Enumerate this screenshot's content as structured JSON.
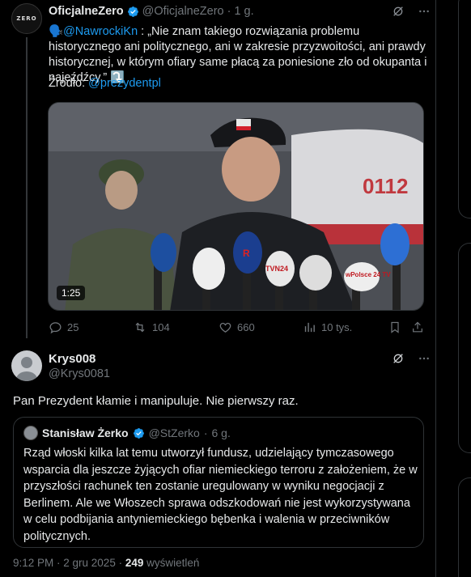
{
  "parent_tweet": {
    "avatar_text": "ZERO",
    "name": "OficjalneZero",
    "handle": "@OficjalneZero",
    "separator": "·",
    "time": "1 g.",
    "mention_prefix": "🗣️",
    "mention": "@NawrockiKn",
    "text": ": „Nie znam takiego rozwiązania problemu historycznego ani politycznego, ani w zakresie przyzwoitości, ani prawdy historycznej, w którym ofiary same płacą za poniesione zło od okupanta i najeźdźcy.” ⤵️",
    "source_label": "Źródło:",
    "source_link": "@prezydentpl",
    "video_duration": "1:25",
    "video_text": {
      "cap_flag": "",
      "plane_number": "0112",
      "mic_labels": [
        "R",
        "TVN24",
        "wPolsce 24 TV"
      ]
    },
    "actions": {
      "replies": "25",
      "reposts": "104",
      "likes": "660",
      "views": "10 tys."
    }
  },
  "reply_tweet": {
    "name": "Krys008",
    "handle": "@Krys0081",
    "text": "Pan Prezydent kłamie i manipuluje. Nie pierwszy raz.",
    "quote": {
      "name": "Stanisław Żerko",
      "handle": "@StZerko",
      "separator": "·",
      "time": "6 g.",
      "text": "Rząd włoski kilka lat temu utworzył fundusz, udzielający tymczasowego wsparcia dla jeszcze żyjących ofiar niemieckiego terroru z założeniem, że w przyszłości rachunek ten zostanie uregulowany w wyniku negocjacji z Berlinem. Ale we Włoszech sprawa odszkodowań nie jest wykorzystywana w celu podbijania antyniemieckiego bębenka i walenia w przeciwników politycznych."
    },
    "meta": {
      "time_date": "9:12 PM · 2 gru 2025 ·",
      "views_count": "249",
      "views_label": "wyświetleń"
    }
  },
  "colors": {
    "background": "#000000",
    "text": "#e7e9ea",
    "muted": "#71767b",
    "accent": "#1d9bf0",
    "border": "#2f3336"
  }
}
